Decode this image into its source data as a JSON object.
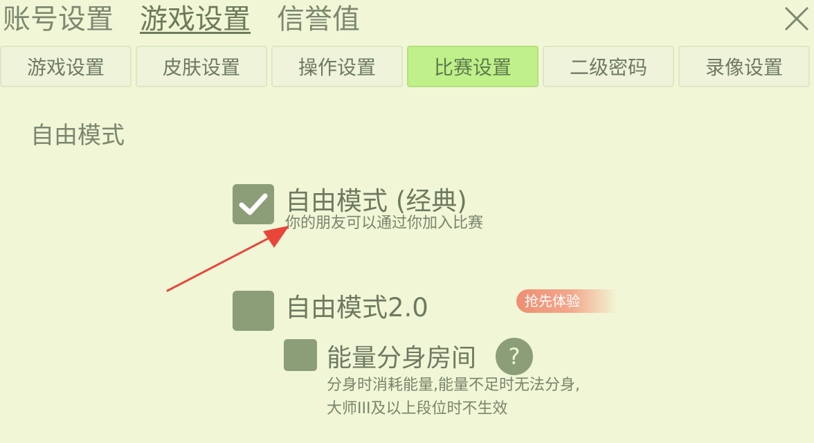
{
  "header": {
    "tabs": [
      {
        "label": "账号设置"
      },
      {
        "label": "游戏设置",
        "active": true
      },
      {
        "label": "信誉值"
      }
    ]
  },
  "subtabs": [
    {
      "label": "游戏设置"
    },
    {
      "label": "皮肤设置"
    },
    {
      "label": "操作设置"
    },
    {
      "label": "比赛设置",
      "active": true
    },
    {
      "label": "二级密码"
    },
    {
      "label": "录像设置"
    }
  ],
  "section": {
    "title": "自由模式"
  },
  "options": {
    "classic": {
      "label": "自由模式 (经典)",
      "desc": "你的朋友可以通过你加入比赛",
      "checked": true
    },
    "v2": {
      "label": "自由模式2.0",
      "badge": "抢先体验",
      "checked": false
    },
    "energy": {
      "label": "能量分身房间",
      "help": "?",
      "desc_line1": "分身时消耗能量,能量不足时无法分身,",
      "desc_line2": "大师III及以上段位时不生效",
      "checked": false
    }
  },
  "icons": {
    "close": "close-icon",
    "check": "checkmark-icon",
    "arrow": "red-arrow-annotation"
  },
  "colors": {
    "background": "#f1f6d6",
    "active_tab": "#bff08a",
    "checkbox": "#8c9e78",
    "badge": "#ee8e72",
    "arrow": "#e8463a"
  }
}
